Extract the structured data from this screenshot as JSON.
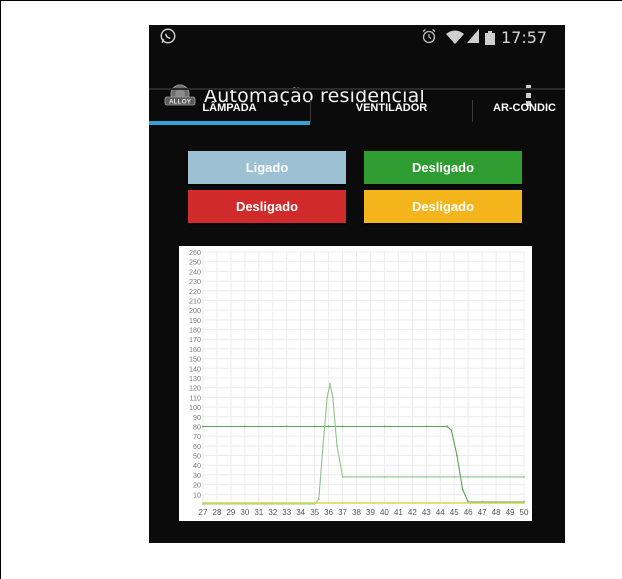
{
  "status_bar": {
    "time": "17:57",
    "icons": [
      "whatsapp-icon",
      "alarm-icon",
      "wifi-icon",
      "signal-icon",
      "battery-icon"
    ]
  },
  "app_bar": {
    "logo_text": "ALLOY",
    "title": "Automação residencial",
    "menu_icon": "overflow-menu-icon"
  },
  "tabs": [
    {
      "label": "LÂMPADA",
      "active": true
    },
    {
      "label": "VENTILADOR",
      "active": false
    },
    {
      "label": "AR-CONDIC",
      "active": false
    }
  ],
  "colors": {
    "accent": "#33a2d6",
    "background": "#0b0b0b",
    "button_ligado": "#9cc1d2",
    "button_green": "#2e9c31",
    "button_red": "#d12a2a",
    "button_orange": "#f4b41b",
    "series_green": "#5aa35a",
    "series_yellow": "#d8d84a"
  },
  "buttons": {
    "b1": "Ligado",
    "b2": "Desligado",
    "b3": "Desligado",
    "b4": "Desligado"
  },
  "chart_data": {
    "type": "line",
    "title": "",
    "xlabel": "",
    "ylabel": "",
    "xlim": [
      27,
      50
    ],
    "ylim": [
      0,
      260
    ],
    "x_ticks": [
      27,
      28,
      29,
      30,
      31,
      32,
      33,
      34,
      35,
      36,
      37,
      38,
      39,
      40,
      41,
      42,
      43,
      44,
      45,
      46,
      47,
      48,
      49,
      50
    ],
    "y_ticks": [
      10,
      20,
      30,
      40,
      50,
      60,
      70,
      80,
      90,
      100,
      110,
      120,
      130,
      140,
      150,
      160,
      170,
      180,
      190,
      200,
      210,
      220,
      230,
      240,
      250,
      260
    ],
    "grid": true,
    "series": [
      {
        "name": "",
        "color": "#5aa35a",
        "x": [
          27,
          30,
          33,
          35,
          36,
          37,
          40,
          43,
          44.5,
          44.8,
          45.2,
          45.6,
          46,
          47,
          50
        ],
        "y": [
          80,
          80,
          80,
          80,
          80,
          80,
          80,
          80,
          80,
          76,
          50,
          15,
          2,
          2,
          2
        ]
      },
      {
        "name": "",
        "color": "#8fc48f",
        "x": [
          27,
          35,
          35.3,
          35.6,
          35.9,
          36.1,
          36.3,
          36.6,
          37,
          40,
          43,
          45,
          46,
          50
        ],
        "y": [
          0,
          0,
          5,
          60,
          110,
          124,
          110,
          60,
          28,
          28,
          28,
          28,
          28,
          28
        ]
      },
      {
        "name": "",
        "color": "#d8d84a",
        "x": [
          27,
          50
        ],
        "y": [
          1,
          1
        ]
      }
    ]
  }
}
